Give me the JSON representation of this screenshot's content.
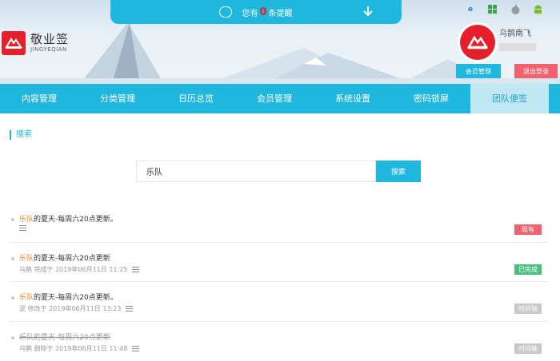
{
  "app": {
    "name": "敬业签",
    "name_en": "JINGYEQIAN"
  },
  "notice": {
    "prefix": "您有",
    "count": "0",
    "suffix": "条提醒"
  },
  "platforms": [
    "ie-icon",
    "windows-icon",
    "apple-icon",
    "android-icon"
  ],
  "user": {
    "name": "乌鹊南飞",
    "member_btn": "会员管理",
    "logout_btn": "退出登录"
  },
  "nav": {
    "items": [
      {
        "label": "内容管理"
      },
      {
        "label": "分类管理"
      },
      {
        "label": "日历总览"
      },
      {
        "label": "会员管理"
      },
      {
        "label": "系统设置"
      },
      {
        "label": "密码锁屏"
      },
      {
        "label": "团队便签"
      }
    ],
    "active_index": 6
  },
  "search": {
    "title": "搜索",
    "value": "乐队",
    "button": "搜索"
  },
  "results": [
    {
      "highlight": "乐队",
      "rest": "的夏天-每周六20点更新。",
      "meta": "",
      "badge": "现有",
      "badge_color": "#f0636e",
      "strike": false
    },
    {
      "highlight": "乐队",
      "rest": "的夏天-每周六20点更新",
      "meta": "乌鹊  完成于 2019年06月11日 11:25",
      "badge": "已完成",
      "badge_color": "#48c27a",
      "strike": false
    },
    {
      "highlight": "乐队",
      "rest": "的夏天-每周六20点更新。",
      "meta": "泥   修改于 2019年06月11日 13:23",
      "badge": "时间轴",
      "badge_color": "#c8c8c8",
      "strike": false
    },
    {
      "highlight": "乐队",
      "rest": "的夏天-每周六20点更新",
      "meta": "乌鹊  删除于 2019年06月11日 11:48",
      "badge": "时间轴",
      "badge_color": "#c8c8c8",
      "strike": true
    }
  ]
}
